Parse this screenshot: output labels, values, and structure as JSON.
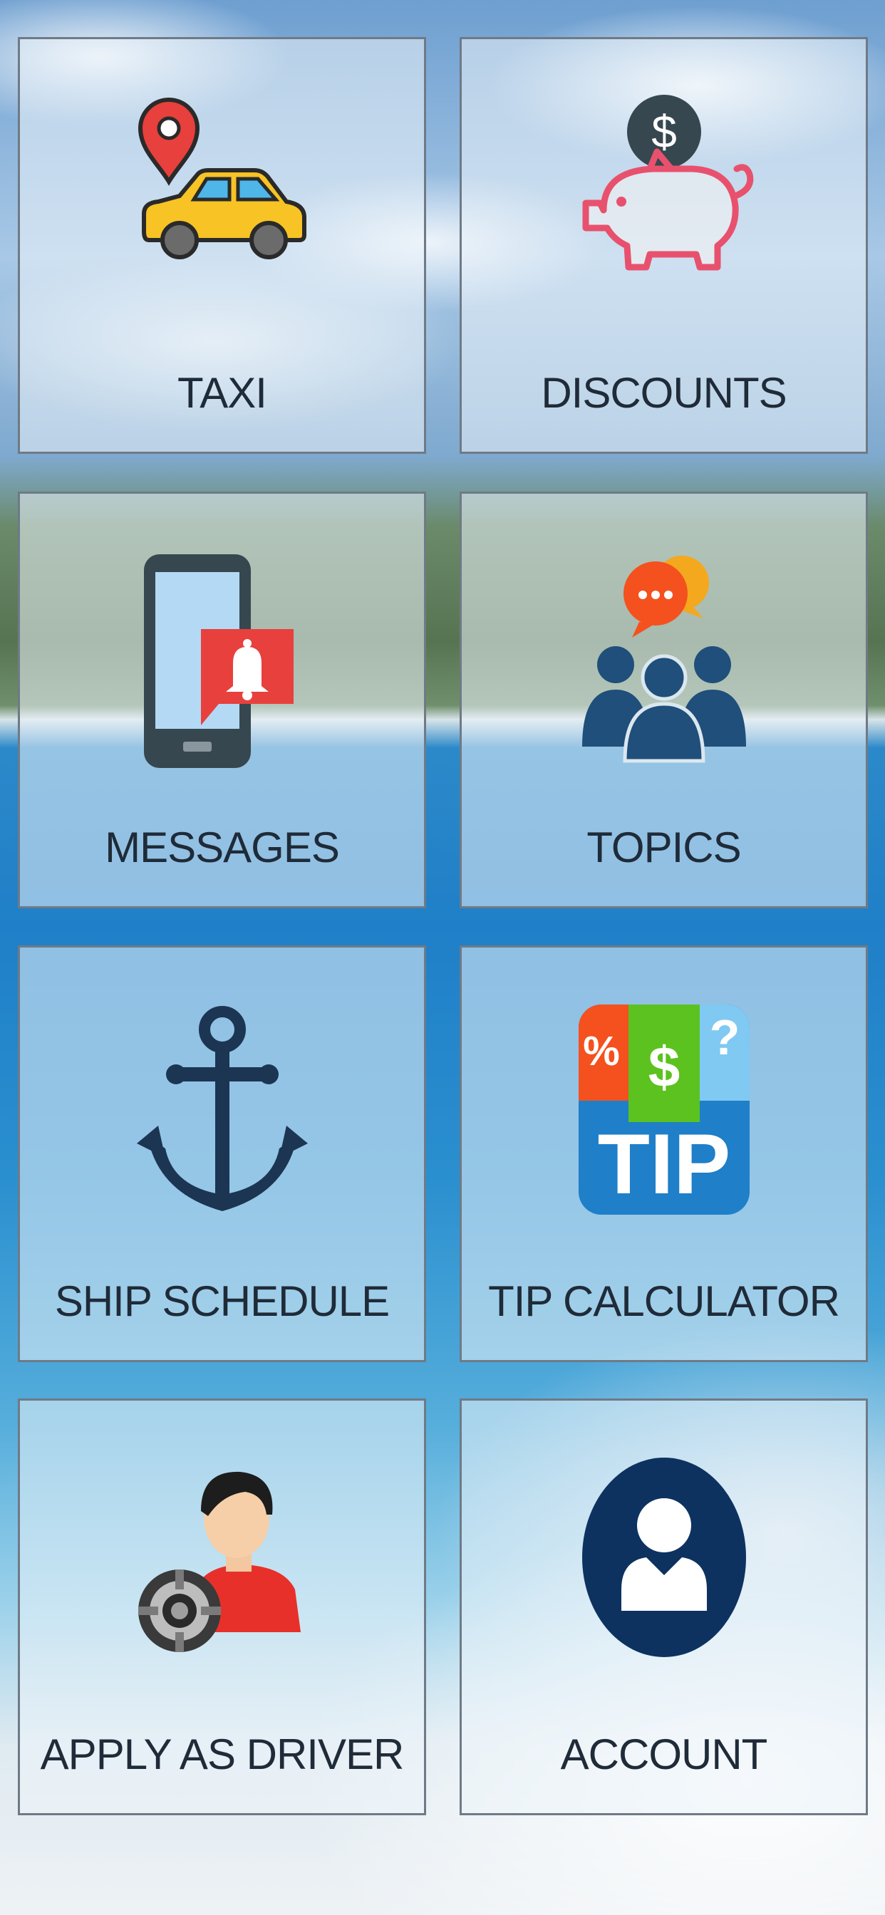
{
  "tiles": [
    {
      "id": "taxi",
      "label": "TAXI",
      "icon": "taxi-pin-icon"
    },
    {
      "id": "discounts",
      "label": "DISCOUNTS",
      "icon": "piggy-bank-icon"
    },
    {
      "id": "messages",
      "label": "MESSAGES",
      "icon": "phone-notification-icon"
    },
    {
      "id": "topics",
      "label": "TOPICS",
      "icon": "group-chat-icon"
    },
    {
      "id": "ship-schedule",
      "label": "SHIP SCHEDULE",
      "icon": "anchor-icon"
    },
    {
      "id": "tip-calculator",
      "label": "TIP CALCULATOR",
      "icon": "tip-calculator-icon"
    },
    {
      "id": "apply-as-driver",
      "label": "APPLY AS DRIVER",
      "icon": "driver-wheel-icon"
    },
    {
      "id": "account",
      "label": "ACCOUNT",
      "icon": "user-account-icon"
    }
  ],
  "icon_text": {
    "tip_percent": "%",
    "tip_dollar": "$",
    "tip_question": "?",
    "tip_word": "TIP",
    "piggy_coin": "$"
  },
  "colors": {
    "tile_border": "#6f7a86",
    "label_text": "#1f2b38",
    "taxi_yellow": "#f7c325",
    "pin_red": "#e8403c",
    "piggy_pink": "#e8516d",
    "coin_dark": "#37474f",
    "phone_dark": "#37474f",
    "bell_red": "#e8403c",
    "people_navy": "#1f4f7a",
    "anchor_navy": "#1c3553",
    "tip_blue": "#1f7fc8",
    "tip_green": "#5cc21f",
    "tip_orange": "#f4511e",
    "tip_light_blue": "#7fc9f2",
    "account_navy": "#0d3260"
  }
}
